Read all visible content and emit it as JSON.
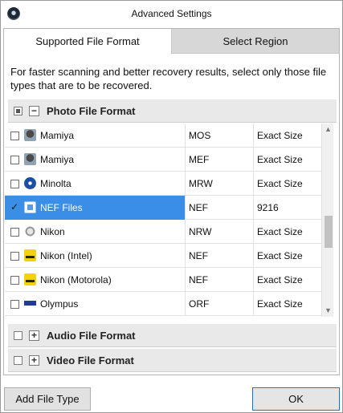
{
  "window": {
    "title": "Advanced Settings"
  },
  "tabs": [
    {
      "label": "Supported File Format",
      "active": true
    },
    {
      "label": "Select Region",
      "active": false
    }
  ],
  "description": "For faster scanning and better recovery results, select only those file types that are to be recovered.",
  "groups": {
    "photo": {
      "title": "Photo File Format",
      "checkbox_state": "partial",
      "expander": "−"
    },
    "audio": {
      "title": "Audio File Format",
      "expander": "+"
    },
    "video": {
      "title": "Video File Format",
      "expander": "+"
    }
  },
  "rows": [
    {
      "name": "Mamiya",
      "ext": "MOS",
      "size": "Exact Size",
      "icon": "mamiya-icon",
      "checked": false,
      "selected": false
    },
    {
      "name": "Mamiya",
      "ext": "MEF",
      "size": "Exact Size",
      "icon": "mamiya-icon",
      "checked": false,
      "selected": false
    },
    {
      "name": "Minolta",
      "ext": "MRW",
      "size": "Exact Size",
      "icon": "minolta-icon",
      "checked": false,
      "selected": false
    },
    {
      "name": "NEF Files",
      "ext": "NEF",
      "size": "9216",
      "icon": "nef-icon",
      "checked": true,
      "selected": true
    },
    {
      "name": "Nikon",
      "ext": "NRW",
      "size": "Exact Size",
      "icon": "nikon-camera-icon",
      "checked": false,
      "selected": false
    },
    {
      "name": "Nikon (Intel)",
      "ext": "NEF",
      "size": "Exact Size",
      "icon": "nikon-icon",
      "checked": false,
      "selected": false
    },
    {
      "name": "Nikon (Motorola)",
      "ext": "NEF",
      "size": "Exact Size",
      "icon": "nikon-icon",
      "checked": false,
      "selected": false
    },
    {
      "name": "Olympus",
      "ext": "ORF",
      "size": "Exact Size",
      "icon": "olympus-icon",
      "checked": false,
      "selected": false
    }
  ],
  "checkmark": "✓",
  "scrollbar": {
    "up_arrow": "▲",
    "down_arrow": "▼"
  },
  "buttons": {
    "add_file_type": "Add File Type",
    "ok": "OK"
  },
  "colors": {
    "selection": "#3a8ee6",
    "tab_inactive": "#d7d7d7",
    "group_header": "#e9e9e9"
  }
}
